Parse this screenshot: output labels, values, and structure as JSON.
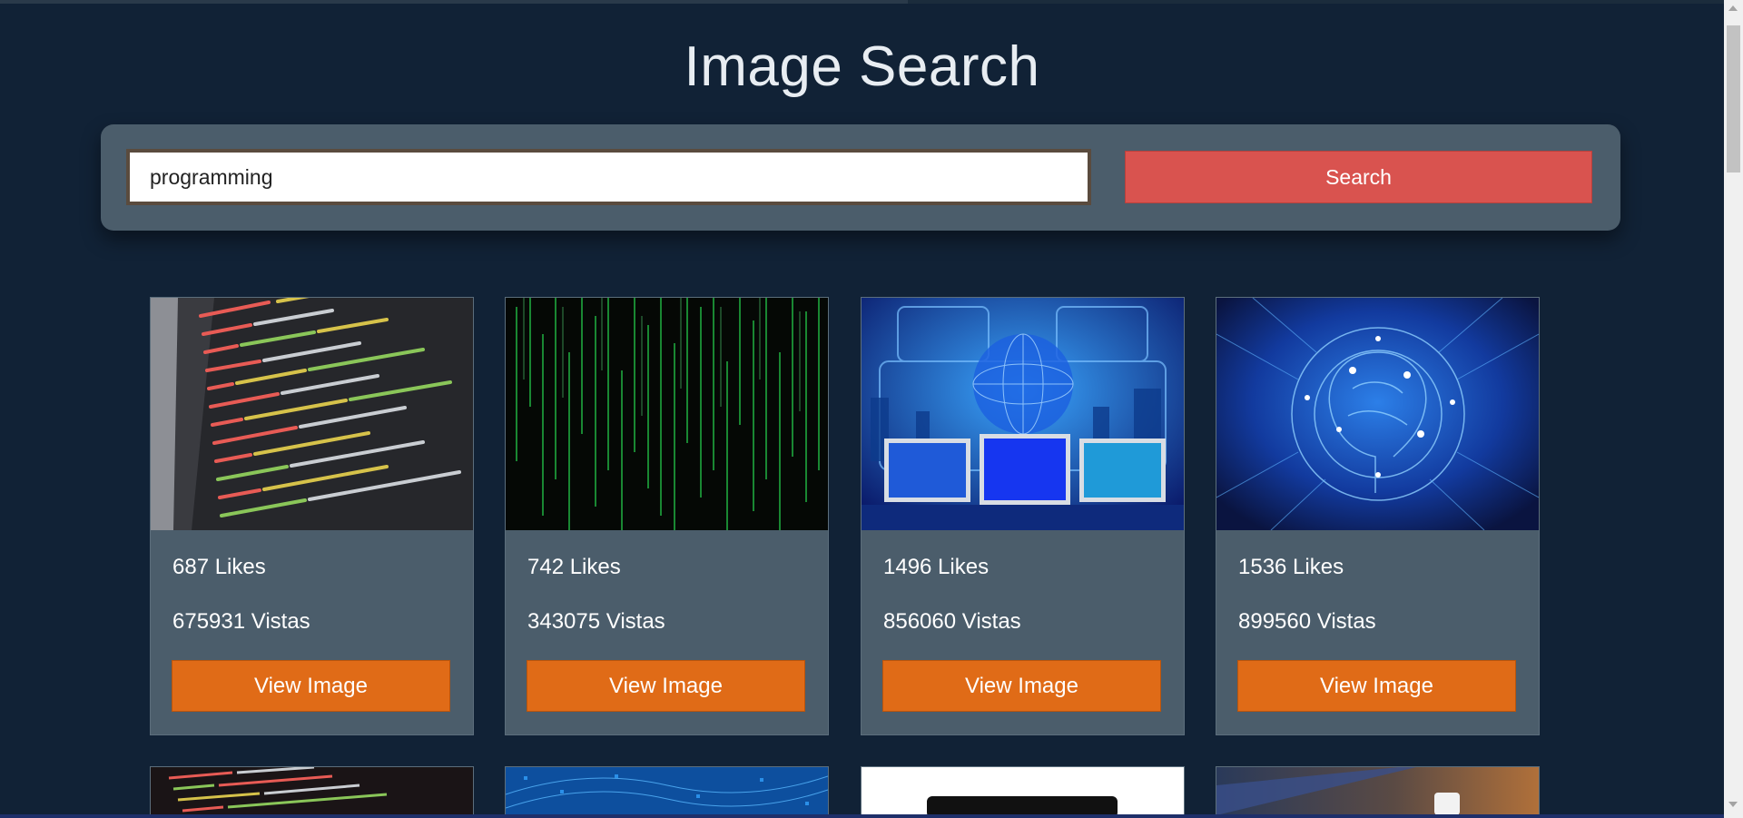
{
  "page": {
    "title": "Image Search"
  },
  "search": {
    "value": "programming",
    "button_label": "Search"
  },
  "results": [
    {
      "likes": "687 Likes",
      "views": "675931 Vistas",
      "button_label": "View Image",
      "image": "code-editor-screen"
    },
    {
      "likes": "742 Likes",
      "views": "343075 Vistas",
      "button_label": "View Image",
      "image": "matrix-green-code"
    },
    {
      "likes": "1496 Likes",
      "views": "856060 Vistas",
      "button_label": "View Image",
      "image": "monitors-city-network"
    },
    {
      "likes": "1536 Likes",
      "views": "899560 Vistas",
      "button_label": "View Image",
      "image": "ai-brain-circuit"
    }
  ],
  "partial_results": [
    {
      "image": "code-screen-dark"
    },
    {
      "image": "blue-digital-pattern"
    },
    {
      "image": "laptop-white"
    },
    {
      "image": "laptop-coffee-desk"
    }
  ],
  "colors": {
    "background": "#112236",
    "panel": "#4b5d6b",
    "search_button": "#d9534f",
    "view_button": "#e06b17"
  }
}
